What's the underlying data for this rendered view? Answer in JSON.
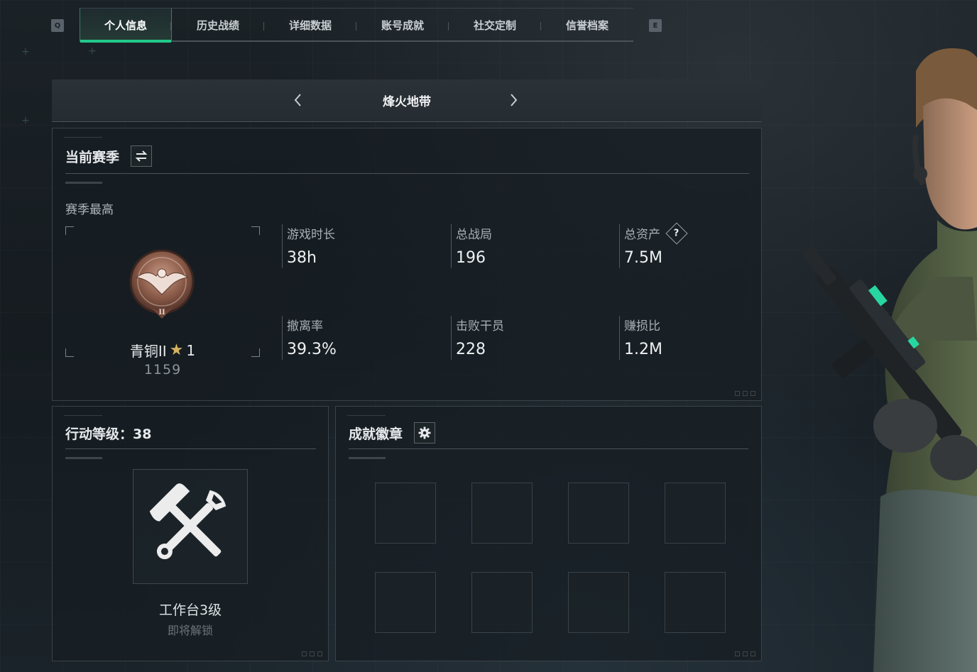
{
  "tabs": {
    "prev_key": "Q",
    "next_key": "E",
    "items": [
      {
        "label": "个人信息",
        "active": true
      },
      {
        "label": "历史战绩",
        "active": false
      },
      {
        "label": "详细数据",
        "active": false
      },
      {
        "label": "账号成就",
        "active": false
      },
      {
        "label": "社交定制",
        "active": false
      },
      {
        "label": "信誉档案",
        "active": false
      }
    ]
  },
  "mode": {
    "title": "烽火地带",
    "prev_icon": "chevron-left-icon",
    "next_icon": "chevron-right-icon"
  },
  "season": {
    "title": "当前赛季",
    "switch_icon": "swap-icon",
    "best_label": "赛季最高",
    "rank": {
      "name": "青铜II",
      "stars": "1",
      "score": "1159",
      "badge_icon": "eagle-bronze-badge-icon"
    },
    "stats": [
      {
        "label": "游戏时长",
        "value": "38h"
      },
      {
        "label": "总战局",
        "value": "196"
      },
      {
        "label": "总资产",
        "value": "7.5M",
        "help": "?"
      },
      {
        "label": "撤离率",
        "value": "39.3%"
      },
      {
        "label": "击败干员",
        "value": "228"
      },
      {
        "label": "赚损比",
        "value": "1.2M"
      }
    ]
  },
  "action_level": {
    "title": "行动等级：38",
    "tool_name": "工作台3级",
    "tool_status": "即将解锁",
    "tool_icon": "hammer-wrench-icon"
  },
  "achievements": {
    "title": "成就徽章",
    "settings_icon": "gear-icon",
    "slots": 8
  },
  "colors": {
    "accent": "#22c98a",
    "background": "#1b2227",
    "panel_border": "#3a4348",
    "bronze": "#a0705a"
  }
}
